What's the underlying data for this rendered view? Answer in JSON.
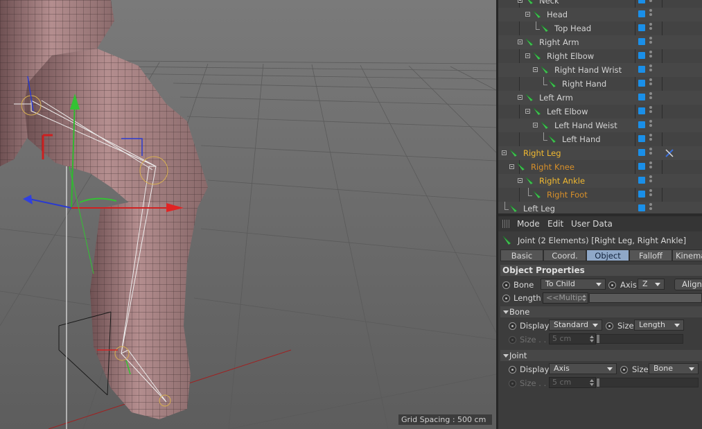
{
  "viewport": {
    "grid_spacing": "Grid Spacing : 500 cm"
  },
  "object_manager": {
    "items": [
      {
        "label": "Neck",
        "state": "normal"
      },
      {
        "label": "Head",
        "state": "normal"
      },
      {
        "label": "Top Head",
        "state": "normal"
      },
      {
        "label": "Right Arm",
        "state": "normal"
      },
      {
        "label": "Right Elbow",
        "state": "normal"
      },
      {
        "label": "Right Hand Wrist",
        "state": "normal"
      },
      {
        "label": "Right Hand",
        "state": "normal"
      },
      {
        "label": "Left Arm",
        "state": "normal"
      },
      {
        "label": "Left Elbow",
        "state": "normal"
      },
      {
        "label": "Left Hand Weist",
        "state": "normal"
      },
      {
        "label": "Left Hand",
        "state": "normal"
      },
      {
        "label": "Right Leg",
        "state": "selected"
      },
      {
        "label": "Right Knee",
        "state": "child-selected"
      },
      {
        "label": "Right Ankle",
        "state": "selected"
      },
      {
        "label": "Right Foot",
        "state": "child-selected"
      },
      {
        "label": "Left Leg",
        "state": "normal"
      }
    ],
    "visibility_color": "#1a8fe8",
    "selected_color": "#f0b830",
    "child_selected_color": "#d8902a"
  },
  "attributes": {
    "menu": [
      "Mode",
      "Edit",
      "User Data"
    ],
    "title": "Joint (2 Elements) [Right Leg, Right Ankle]",
    "tabs": [
      {
        "label": "Basic",
        "active": false
      },
      {
        "label": "Coord.",
        "active": false
      },
      {
        "label": "Object",
        "active": true
      },
      {
        "label": "Falloff",
        "active": false
      },
      {
        "label": "Kinemat",
        "active": false
      }
    ],
    "object_properties": {
      "header": "Object Properties",
      "bone_label": "Bone",
      "bone_value": "To Child",
      "axis_label": "Axis",
      "axis_value": "Z",
      "align_button": "Align",
      "length_label": "Length",
      "length_value": "<<Multip"
    },
    "bone_group": {
      "header": "Bone",
      "display_label": "Display",
      "display_value": "Standard",
      "size_label": "Size",
      "size_value": "Length",
      "size2_label": "Size . . .",
      "size2_value": "5 cm"
    },
    "joint_group": {
      "header": "Joint",
      "display_label": "Display",
      "display_value": "Axis",
      "size_label": "Size",
      "size_value": "Bone",
      "size2_label": "Size . . .",
      "size2_value": "5 cm"
    }
  }
}
